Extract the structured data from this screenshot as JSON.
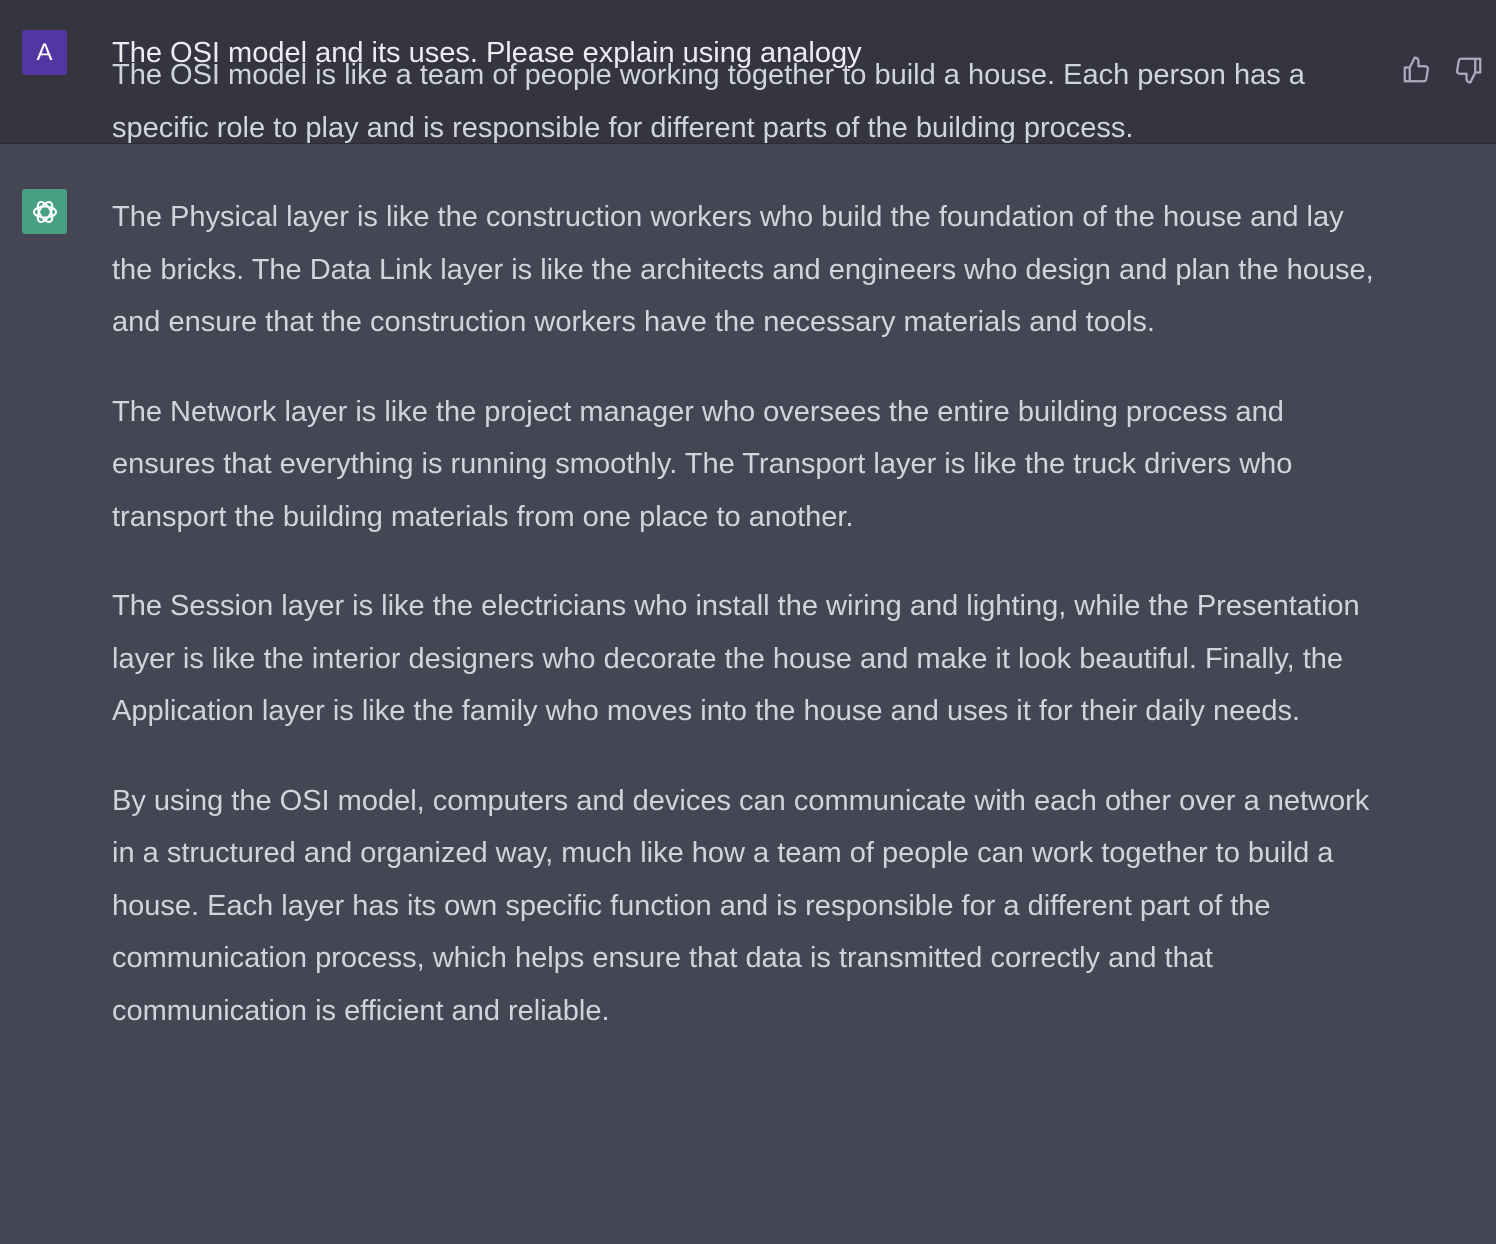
{
  "user_message": {
    "avatar_initial": "A",
    "text": "The OSI model and its uses. Please explain using analogy"
  },
  "assistant_message": {
    "avatar_icon": "openai-logo-icon",
    "paragraphs": [
      "The OSI model is like a team of people working together to build a house. Each person has a specific role to play and is responsible for different parts of the building process.",
      "The Physical layer is like the construction workers who build the foundation of the house and lay the bricks. The Data Link layer is like the architects and engineers who design and plan the house, and ensure that the construction workers have the necessary materials and tools.",
      "The Network layer is like the project manager who oversees the entire building process and ensures that everything is running smoothly. The Transport layer is like the truck drivers who transport the building materials from one place to another.",
      "The Session layer is like the electricians who install the wiring and lighting, while the Presentation layer is like the interior designers who decorate the house and make it look beautiful. Finally, the Application layer is like the family who moves into the house and uses it for their daily needs.",
      "By using the OSI model, computers and devices can communicate with each other over a network in a structured and organized way, much like how a team of people can work together to build a house. Each layer has its own specific function and is responsible for a different part of the communication process, which helps ensure that data is transmitted correctly and that communication is efficient and reliable."
    ],
    "feedback": {
      "thumbs_up_icon": "thumbs-up-icon",
      "thumbs_down_icon": "thumbs-down-icon"
    }
  },
  "colors": {
    "user_background": "#343541",
    "assistant_background": "#444654",
    "user_avatar": "#5436a3",
    "assistant_avatar": "#4aa181",
    "user_text": "#ececf1",
    "assistant_text": "#d1d5db"
  }
}
